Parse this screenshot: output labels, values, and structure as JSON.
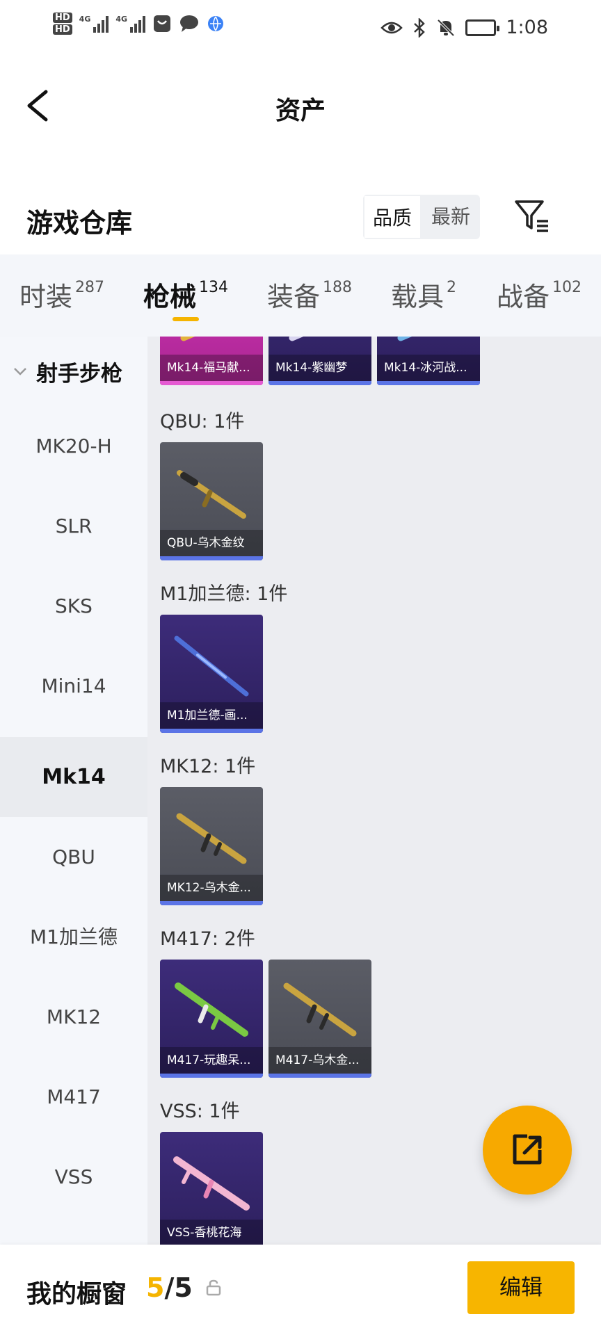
{
  "status_bar": {
    "hd1": "HD",
    "hd2": "HD",
    "net1": "4G",
    "net2": "4G",
    "time": "1:08"
  },
  "header": {
    "title": "资产"
  },
  "warehouse": {
    "title": "游戏仓库",
    "sort_options": [
      "品质",
      "最新"
    ],
    "selected_sort": "品质"
  },
  "tabs": [
    {
      "label": "时装",
      "count": "287"
    },
    {
      "label": "枪械",
      "count": "134"
    },
    {
      "label": "装备",
      "count": "188"
    },
    {
      "label": "载具",
      "count": "2"
    },
    {
      "label": "战备",
      "count": "102"
    }
  ],
  "active_tab": "枪械",
  "sidebar": {
    "category": "射手步枪",
    "items": [
      "MK20-H",
      "SLR",
      "SKS",
      "Mini14",
      "Mk14",
      "QBU",
      "M1加兰德",
      "MK12",
      "M417",
      "VSS"
    ],
    "active": "Mk14"
  },
  "groups": {
    "mk14": {
      "items": [
        {
          "name": "Mk14-福马献...",
          "rarity": "pink"
        },
        {
          "name": "Mk14-紫幽梦",
          "rarity": "purple"
        },
        {
          "name": "Mk14-冰河战...",
          "rarity": "purple"
        }
      ]
    },
    "qbu": {
      "title": "QBU: 1件",
      "items": [
        {
          "name": "QBU-乌木金纹",
          "rarity": "gray"
        }
      ]
    },
    "m1": {
      "title": "M1加兰德: 1件",
      "items": [
        {
          "name": "M1加兰德-画...",
          "rarity": "purple"
        }
      ]
    },
    "mk12": {
      "title": "MK12: 1件",
      "items": [
        {
          "name": "MK12-乌木金...",
          "rarity": "gray"
        }
      ]
    },
    "m417": {
      "title": "M417: 2件",
      "items": [
        {
          "name": "M417-玩趣呆...",
          "rarity": "purple"
        },
        {
          "name": "M417-乌木金...",
          "rarity": "gray"
        }
      ]
    },
    "vss": {
      "title": "VSS: 1件",
      "items": [
        {
          "name": "VSS-香桃花海",
          "rarity": "purple"
        }
      ]
    }
  },
  "bottom_bar": {
    "label": "我的橱窗",
    "current": "5",
    "separator": "/",
    "total": "5",
    "edit_label": "编辑"
  },
  "colors": {
    "accent": "#f5b400",
    "fab": "#f7a900",
    "card_gray": "#55575f",
    "card_purple": "#35266c",
    "card_pink": "#c92eb0"
  }
}
